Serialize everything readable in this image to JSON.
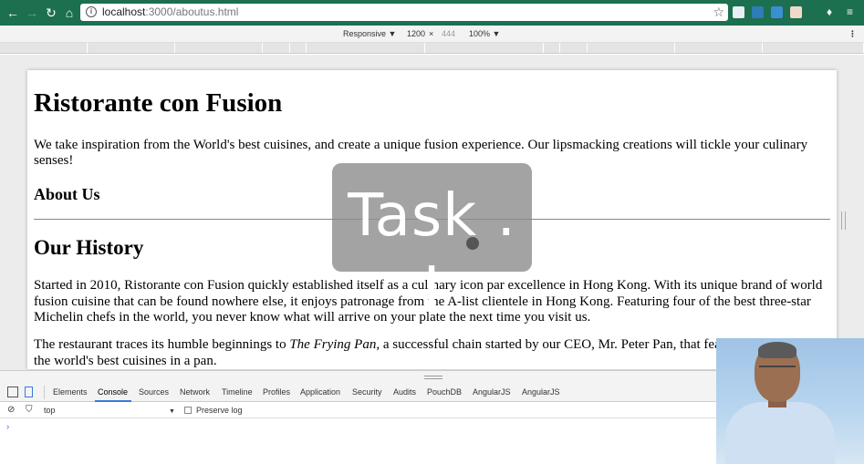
{
  "browser": {
    "url_host": "localhost",
    "url_path": ":3000/aboutus.html",
    "colors": {
      "toolbar": "#1c6f4f",
      "accent": "#3879d9"
    }
  },
  "device_toolbar": {
    "mode": "Responsive ▼",
    "width": "1200",
    "times": "×",
    "height": "444",
    "zoom": "100% ▼",
    "menu": "⋮"
  },
  "page": {
    "title": "Ristorante con Fusion",
    "intro": "We take inspiration from the World's best cuisines, and create a unique fusion experience. Our lipsmacking creations will tickle your culinary senses!",
    "about_heading": "About Us",
    "history_heading": "Our History",
    "history_p1": "Started in 2010, Ristorante con Fusion quickly established itself as a culinary icon par excellence in Hong Kong. With its unique brand of world fusion cuisine that can be found nowhere else, it enjoys patronage from the A-list clientele in Hong Kong. Featuring four of the best three-star Michelin chefs in the world, you never know what will arrive on your plate the next time you visit us.",
    "history_p2_before": "The restaurant traces its humble beginnings to ",
    "history_p2_em": "The Frying Pan",
    "history_p2_after": ", a successful chain started by our CEO, Mr. Peter Pan, that featu",
    "history_p2_line2": "the world's best cuisines in a pan."
  },
  "overlay": {
    "text": "Task . I"
  },
  "devtools": {
    "tabs": [
      "Elements",
      "Console",
      "Sources",
      "Network",
      "Timeline",
      "Profiles",
      "Application",
      "Security",
      "Audits",
      "PouchDB",
      "AngularJS",
      "AngularJS"
    ],
    "active_tab": "Console",
    "context": "top",
    "context_arrow": "▼",
    "preserve_log": "Preserve log",
    "prompt": "›"
  }
}
